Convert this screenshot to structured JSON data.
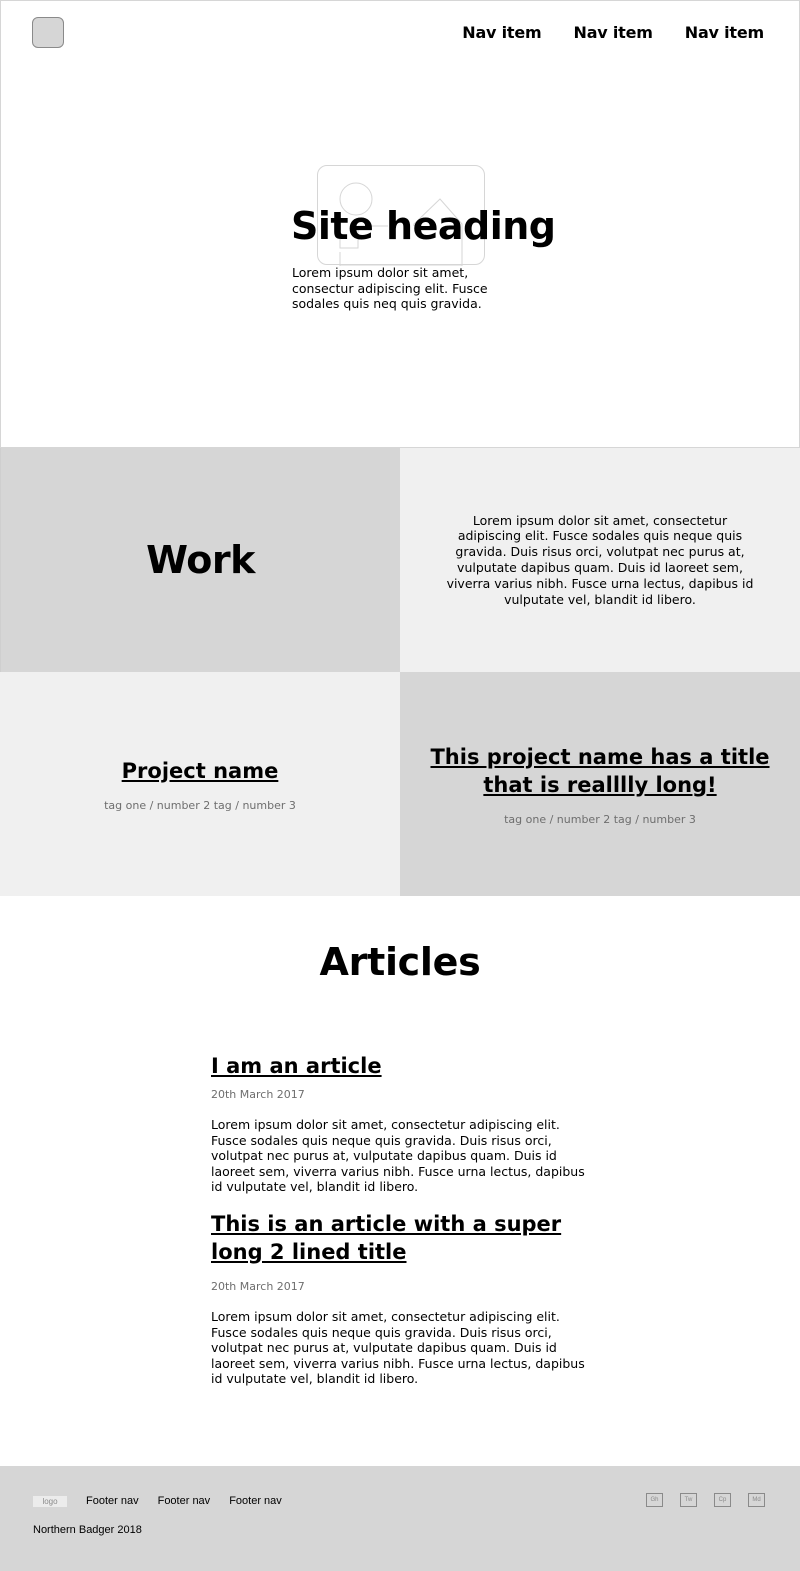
{
  "header": {
    "nav": [
      "Nav item",
      "Nav item",
      "Nav item"
    ],
    "site_heading": "Site heading",
    "hero_text": "Lorem ipsum dolor sit amet, consectur adipiscing elit. Fusce sodales quis neq quis gravida."
  },
  "work": {
    "title": "Work",
    "description": "Lorem ipsum dolor sit amet, consectetur adipiscing elit. Fusce sodales quis neque quis gravida. Duis risus orci, volutpat nec purus at, vulputate dapibus quam. Duis id laoreet sem, viverra varius nibh. Fusce urna lectus, dapibus id vulputate vel, blandit id libero.",
    "projects": [
      {
        "name": "Project name",
        "tags": "tag one / number 2 tag / number 3"
      },
      {
        "name": "This project name has a title that is realllly long!",
        "tags": "tag one / number 2 tag / number 3"
      }
    ]
  },
  "articles": {
    "title": "Articles",
    "items": [
      {
        "title": "I am an article",
        "date": "20th March 2017",
        "body": "Lorem ipsum dolor sit amet, consectetur adipiscing elit. Fusce sodales quis neque quis gravida. Duis risus orci, volutpat nec purus at, vulputate dapibus quam. Duis id laoreet sem, viverra varius nibh. Fusce urna lectus, dapibus id vulputate vel, blandit id libero."
      },
      {
        "title": "This is an article with a super long 2 lined title",
        "date": "20th March 2017",
        "body": "Lorem ipsum dolor sit amet, consectetur adipiscing elit. Fusce sodales quis neque quis gravida. Duis risus orci, volutpat nec purus at, vulputate dapibus quam. Duis id laoreet sem, viverra varius nibh. Fusce urna lectus, dapibus id vulputate vel, blandit id libero."
      }
    ]
  },
  "footer": {
    "logo": "logo",
    "nav": [
      "Footer nav",
      "Footer nav",
      "Footer nav"
    ],
    "copyright": "Northern Badger 2018",
    "social": [
      "Gh",
      "Tw",
      "Cp",
      "Md"
    ]
  },
  "colors": {
    "panel_dark": "#d6d6d6",
    "panel_light": "#f0f0f0",
    "muted_text": "#6e6e6e"
  }
}
